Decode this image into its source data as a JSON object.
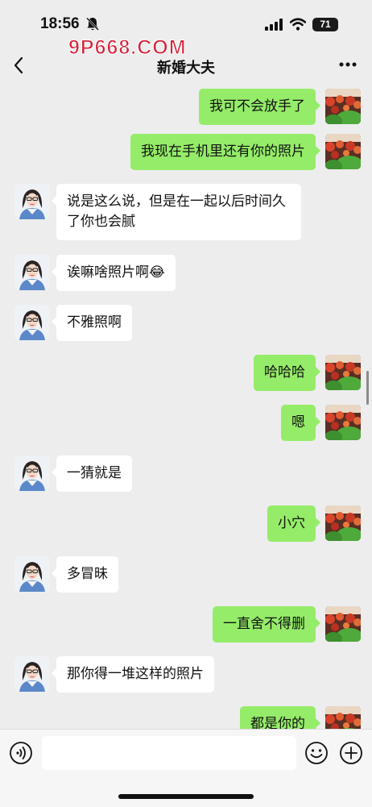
{
  "status_bar": {
    "time": "18:56",
    "battery": "71",
    "icons": [
      "bell-off-icon",
      "signal-icon",
      "wifi-icon",
      "battery-icon"
    ]
  },
  "watermark": "9P668.COM",
  "header": {
    "title": "新婚大夫",
    "icons": [
      "back-chevron-icon",
      "more-icon"
    ]
  },
  "messages": [
    {
      "side": "out",
      "text": "我可不会放手了"
    },
    {
      "side": "out",
      "text": "我现在手机里还有你的照片"
    },
    {
      "side": "in",
      "text": "说是这么说，但是在一起以后时间久了你也会腻"
    },
    {
      "side": "in",
      "text": "诶嘛啥照片啊😂"
    },
    {
      "side": "in",
      "text": "不雅照啊"
    },
    {
      "side": "out",
      "text": "哈哈哈"
    },
    {
      "side": "out",
      "text": "嗯"
    },
    {
      "side": "in",
      "text": "一猜就是"
    },
    {
      "side": "out",
      "text": "小穴"
    },
    {
      "side": "in",
      "text": "多冒昧"
    },
    {
      "side": "out",
      "text": "一直舍不得删"
    },
    {
      "side": "in",
      "text": "那你得一堆这样的照片"
    },
    {
      "side": "out",
      "text": "都是你的"
    }
  ],
  "input_bar": {
    "icons": [
      "voice-icon",
      "emoji-icon",
      "plus-icon"
    ]
  },
  "colors": {
    "background": "#ededed",
    "outgoing_bubble": "#95ec69",
    "incoming_bubble": "#ffffff",
    "watermark": "#d4233a"
  }
}
